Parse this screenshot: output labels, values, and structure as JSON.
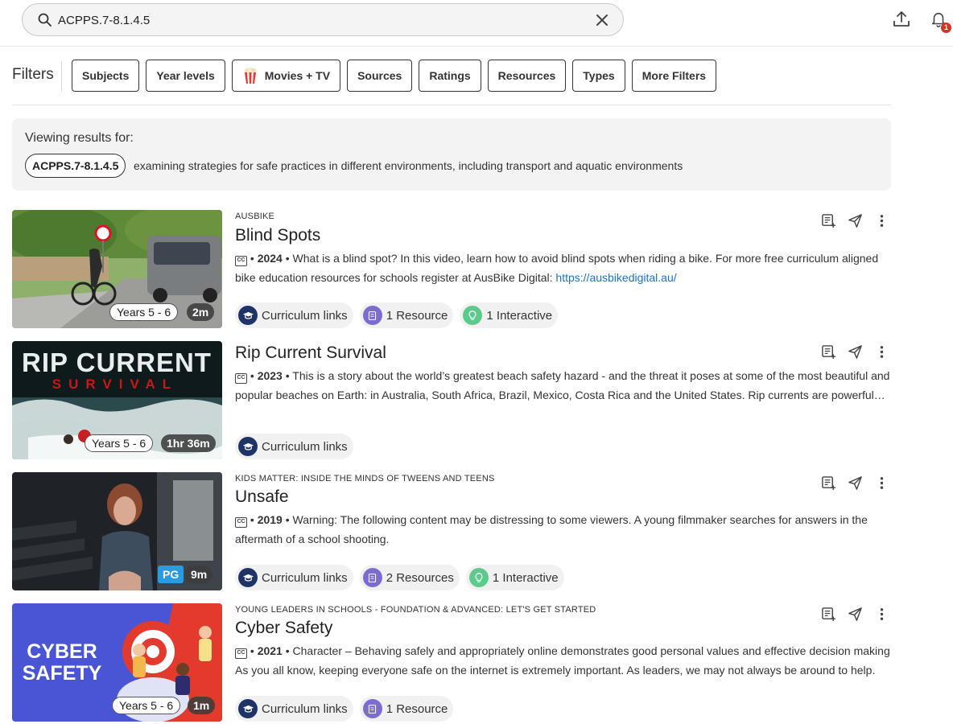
{
  "search": {
    "query": "ACPPS.7-8.1.4.5"
  },
  "header": {
    "notification_count": "1",
    "icons": [
      "search-icon",
      "close-icon",
      "upload-icon",
      "bell-icon"
    ]
  },
  "filters": {
    "label": "Filters",
    "buttons": [
      "Subjects",
      "Year levels",
      "Movies + TV",
      "Sources",
      "Ratings",
      "Resources",
      "Types",
      "More Filters"
    ]
  },
  "viewing": {
    "label": "Viewing results for:",
    "code": "ACPPS.7-8.1.4.5",
    "description": "examining strategies for safe practices in different environments, including transport and aquatic environments"
  },
  "colors": {
    "link": "#1a73c8",
    "curriculum": "#1e3466",
    "resource": "#7b6dd0",
    "interactive": "#5fc98c",
    "badge": "#d93025",
    "pg": "#2b9be0"
  },
  "results": [
    {
      "source": "AUSBIKE",
      "title": "Blind Spots",
      "year": "2024",
      "description": "What is a blind spot? In this video, learn how to avoid blind spots when riding a bike. For more free curriculum aligned bike education resources for schools register at AusBike Digital:",
      "link": "https://ausbikedigital.au/",
      "year_level": "Years 5 - 6",
      "duration": "2m",
      "chips": {
        "curriculum": "Curriculum links",
        "resources": "1 Resource",
        "interactive": "1 Interactive"
      }
    },
    {
      "source": "",
      "title": "Rip Current Survival",
      "year": "2023",
      "description": "This is a story about the world’s greatest beach safety hazard - and the threat it poses at some of the most beautiful and popular beaches on Earth: in Australia, South Africa, Brazil, Mexico, Costa Rica and the United States. Rip currents are powerful channels of water that can drag even strong swimmers out to sea.",
      "year_level": "Years 5 - 6",
      "duration": "1hr 36m",
      "thumb_text": {
        "line1": "RIP CURRENT",
        "line2": "SURVIVAL"
      },
      "chips": {
        "curriculum": "Curriculum links"
      }
    },
    {
      "source": "KIDS MATTER: INSIDE THE MINDS OF TWEENS AND TEENS",
      "title": "Unsafe",
      "year": "2019",
      "description": "Warning: The following content may be distressing to some viewers. A young filmmaker searches for answers in the aftermath of a school shooting.",
      "rating": "PG",
      "duration": "9m",
      "chips": {
        "curriculum": "Curriculum links",
        "resources": "2 Resources",
        "interactive": "1 Interactive"
      }
    },
    {
      "source": "YOUNG LEADERS IN SCHOOLS - FOUNDATION & ADVANCED: LET'S GET STARTED",
      "title": "Cyber Safety",
      "year": "2021",
      "description": "Character – Behaving safely and appropriately online demonstrates good personal values and effective decision making As you all know, keeping everyone safe on the internet is extremely important. As leaders, we may not always be around to help.",
      "year_level": "Years 5 - 6",
      "duration": "1m",
      "thumb_text": {
        "line1": "CYBER",
        "line2": "SAFETY"
      },
      "chips": {
        "curriculum": "Curriculum links",
        "resources": "1 Resource"
      }
    }
  ]
}
